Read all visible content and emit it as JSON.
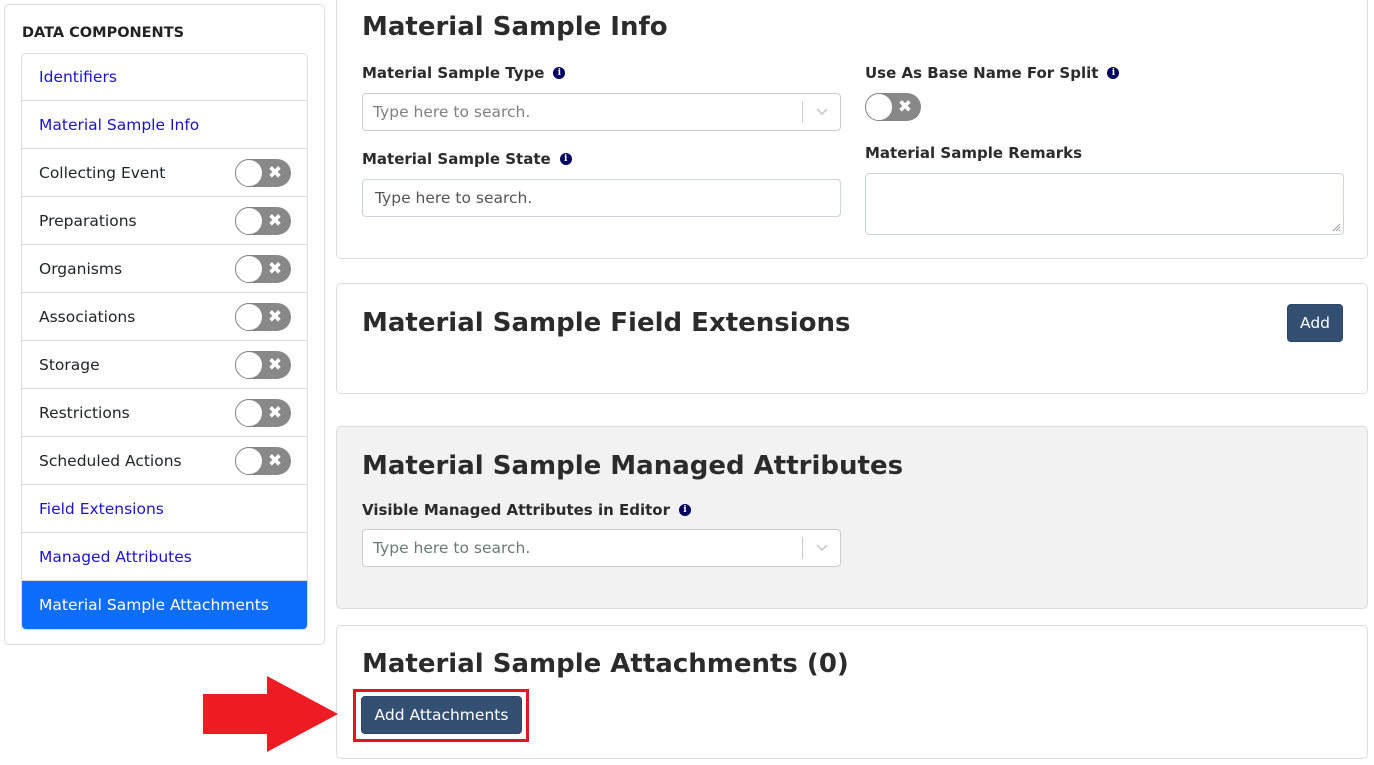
{
  "sidebar": {
    "title": "DATA COMPONENTS",
    "items": [
      {
        "label": "Identifiers",
        "type": "link"
      },
      {
        "label": "Material Sample Info",
        "type": "link"
      },
      {
        "label": "Collecting Event",
        "type": "toggle",
        "enabled": false
      },
      {
        "label": "Preparations",
        "type": "toggle",
        "enabled": false
      },
      {
        "label": "Organisms",
        "type": "toggle",
        "enabled": false
      },
      {
        "label": "Associations",
        "type": "toggle",
        "enabled": false
      },
      {
        "label": "Storage",
        "type": "toggle",
        "enabled": false
      },
      {
        "label": "Restrictions",
        "type": "toggle",
        "enabled": false
      },
      {
        "label": "Scheduled Actions",
        "type": "toggle",
        "enabled": false
      },
      {
        "label": "Field Extensions",
        "type": "link"
      },
      {
        "label": "Managed Attributes",
        "type": "link"
      },
      {
        "label": "Material Sample Attachments",
        "type": "active"
      }
    ]
  },
  "sample_info": {
    "title": "Material Sample Info",
    "type_label": "Material Sample Type",
    "type_placeholder": "Type here to search.",
    "state_label": "Material Sample State",
    "state_placeholder": "Type here to search.",
    "base_name_label": "Use As Base Name For Split",
    "base_name_enabled": false,
    "remarks_label": "Material Sample Remarks",
    "remarks_value": ""
  },
  "field_extensions": {
    "title": "Material Sample Field Extensions",
    "add_label": "Add"
  },
  "managed_attributes": {
    "title": "Material Sample Managed Attributes",
    "visible_label": "Visible Managed Attributes in Editor",
    "visible_placeholder": "Type here to search."
  },
  "attachments": {
    "title": "Material Sample Attachments (0)",
    "add_label": "Add Attachments"
  },
  "icons": {
    "info": "i",
    "toggle_off": "✖"
  },
  "colors": {
    "active": "#0d6efd",
    "button": "#334f72",
    "annotation": "#e8141c"
  }
}
